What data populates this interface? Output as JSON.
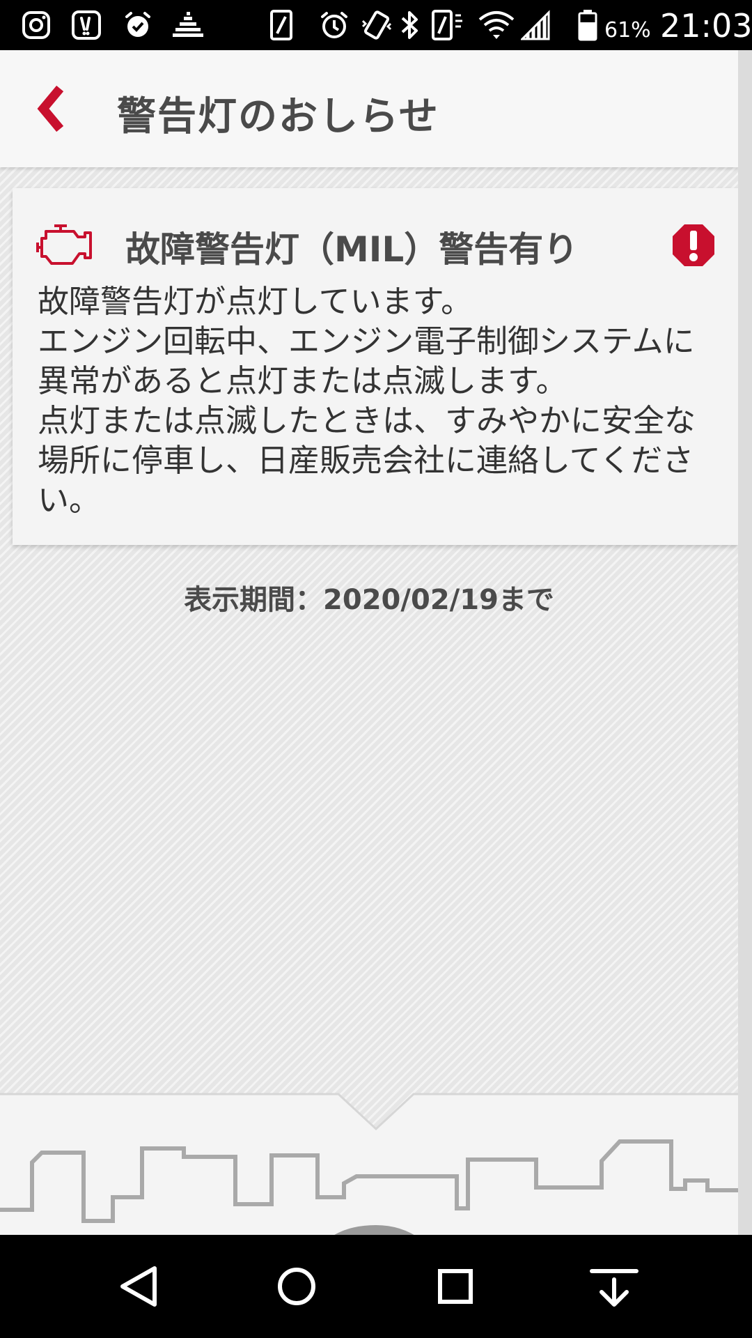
{
  "status_bar": {
    "battery_percent": "61%",
    "time": "21:03",
    "icons_left": [
      "instagram-icon",
      "app-notification-icon",
      "alarm-app-icon",
      "equalizer-icon"
    ],
    "icons_right": [
      "portrait-lock-icon",
      "alarm-icon",
      "vibrate-icon",
      "bluetooth-icon",
      "data-saver-icon",
      "wifi-icon",
      "cell-signal-icon",
      "battery-icon"
    ]
  },
  "header": {
    "title": "警告灯のおしらせ",
    "back_icon": "chevron-left-icon"
  },
  "alert_card": {
    "icon": "engine-warning-icon",
    "title": "故障警告灯（MIL）警告有り",
    "badge_icon": "exclamation-octagon-icon",
    "body": [
      "故障警告灯が点灯しています。",
      "エンジン回転中、エンジン電子制御システムに異常があると点灯または点滅します。",
      "点灯または点滅したときは、すみやかに安全な場所に停車し、日産販売会社に連絡してください。"
    ]
  },
  "display_period": "表示期間：2020/02/19まで",
  "illustration": {
    "icons": [
      "city-skyline-icon",
      "car-icon"
    ]
  },
  "nav_bar": {
    "buttons": [
      "back-triangle-icon",
      "home-circle-icon",
      "recents-square-icon",
      "notification-pull-icon"
    ]
  },
  "colors": {
    "accent": "#c8102e",
    "text": "#4a4a4a",
    "card_bg": "#f4f4f4",
    "background": "#e6e6e6",
    "illustration_line": "#a9a9a9"
  }
}
